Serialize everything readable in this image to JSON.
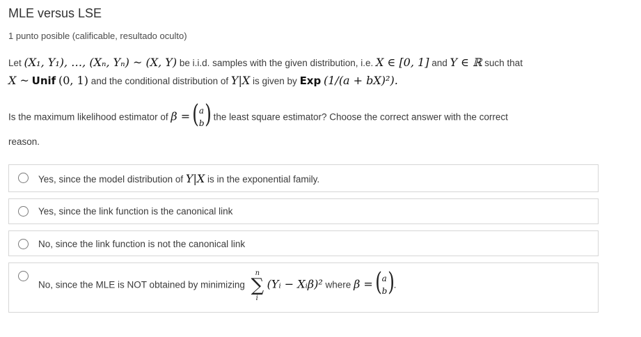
{
  "header": {
    "title": "MLE versus LSE",
    "subtitle": "1 punto posible (calificable, resultado oculto)"
  },
  "problem": {
    "line1_let": "Let",
    "line1_samples": "(X₁, Y₁), …, (Xₙ, Yₙ) ~ (X, Y)",
    "line1_mid": "be i.i.d. samples with the given distribution, i.e.",
    "line1_x": "X ∈ [0, 1]",
    "line1_and": "and",
    "line1_y": "Y ∈ ℝ",
    "line1_end": "such that",
    "line2_x": "X ~",
    "line2_unif": "Unif",
    "line2_unif_args": "(0, 1)",
    "line2_mid": "and the conditional distribution of",
    "line2_yx": "Y|X",
    "line2_given": "is given by",
    "line2_exp": "Exp",
    "line2_exp_args": "(1/(a + bX)²).",
    "question_pre": "Is the maximum likelihood estimator of",
    "question_beta": "β =",
    "question_post": "the least square estimator? Choose the correct answer with the correct",
    "question_cont": "reason.",
    "vec_a": "a",
    "vec_b": "b"
  },
  "options": [
    {
      "pre": "Yes, since the model distribution of",
      "math": "Y|X",
      "post": "is in the exponential family."
    },
    {
      "text": "Yes, since the link function is the canonical link"
    },
    {
      "text": "No, since the link function is not the canonical link"
    },
    {
      "pre": "No, since the MLE is NOT obtained by minimizing",
      "sum_top": "n",
      "sum_bottom": "i",
      "expr": "(Yᵢ − Xᵢβ)²",
      "where": "where",
      "beta": "β =",
      "vec_a": "a",
      "vec_b": "b",
      "tail": "."
    }
  ]
}
